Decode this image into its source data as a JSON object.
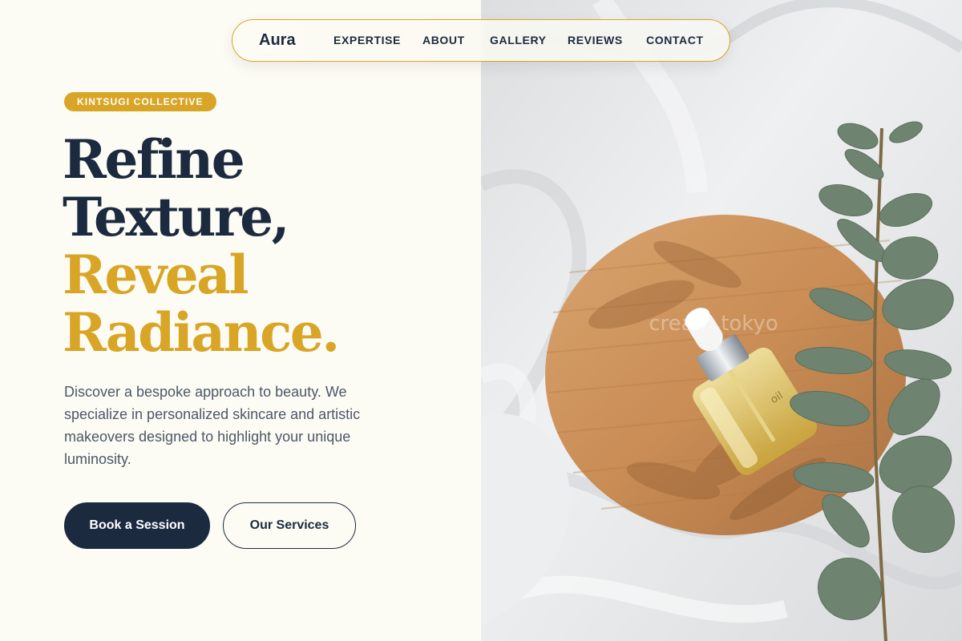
{
  "nav": {
    "brand": "Aura",
    "links": [
      "EXPERTISE",
      "ABOUT",
      "GALLERY",
      "REVIEWS",
      "CONTACT"
    ]
  },
  "hero": {
    "badge": "KINTSUGI COLLECTIVE",
    "headline": {
      "line1": "Refine",
      "line2": "Texture,",
      "line3": "Reveal",
      "line4": "Radiance."
    },
    "description": "Discover a bespoke approach to beauty. We specialize in personalized skincare and artistic makeovers designed to highlight your unique luminosity.",
    "primary_button": "Book a Session",
    "secondary_button": "Our Services"
  },
  "photo": {
    "watermark": "cream tokyo",
    "bottle_label": "oil"
  },
  "colors": {
    "navy": "#1c2a40",
    "gold": "#d8a526",
    "cream": "#fdfcf4",
    "body_text": "#4c5768"
  }
}
